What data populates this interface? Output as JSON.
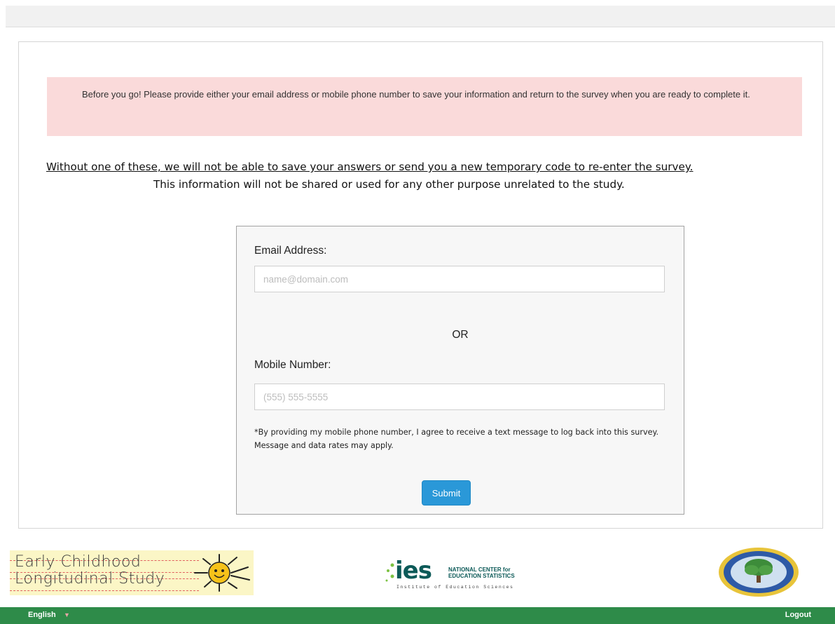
{
  "alert": {
    "text": "Before you go! Please provide either your email address or mobile phone number to save your information and return to the survey when you are ready to complete it."
  },
  "warning": {
    "line1": "Without one of these, we will not be able to save your answers or send you a new temporary code to re-enter the survey.",
    "line2": "This information will not be shared or used for any other purpose unrelated to the study."
  },
  "form": {
    "email_label": "Email Address:",
    "email_placeholder": "name@domain.com",
    "email_value": "",
    "or_label": "OR",
    "mobile_label": "Mobile Number:",
    "mobile_placeholder": "(555) 555-5555",
    "mobile_value": "",
    "disclaimer": "*By providing my mobile phone number, I agree to receive a text message to log back into this survey. Message and data rates may apply.",
    "submit_label": "Submit"
  },
  "logos": {
    "ecls_line1": "Early Childhood",
    "ecls_line2": "Longitudinal Study",
    "ies_word": "ies",
    "ies_nces_line1": "NATIONAL CENTER for",
    "ies_nces_line2": "EDUCATION STATISTICS",
    "ies_subtitle": "Institute of Education Sciences"
  },
  "footer": {
    "language": "English",
    "language_icon": "chevron-down-icon",
    "logout_label": "Logout"
  },
  "colors": {
    "alert_bg": "#fadada",
    "submit_bg": "#2a98d8",
    "footer_bg": "#2e8b49"
  }
}
